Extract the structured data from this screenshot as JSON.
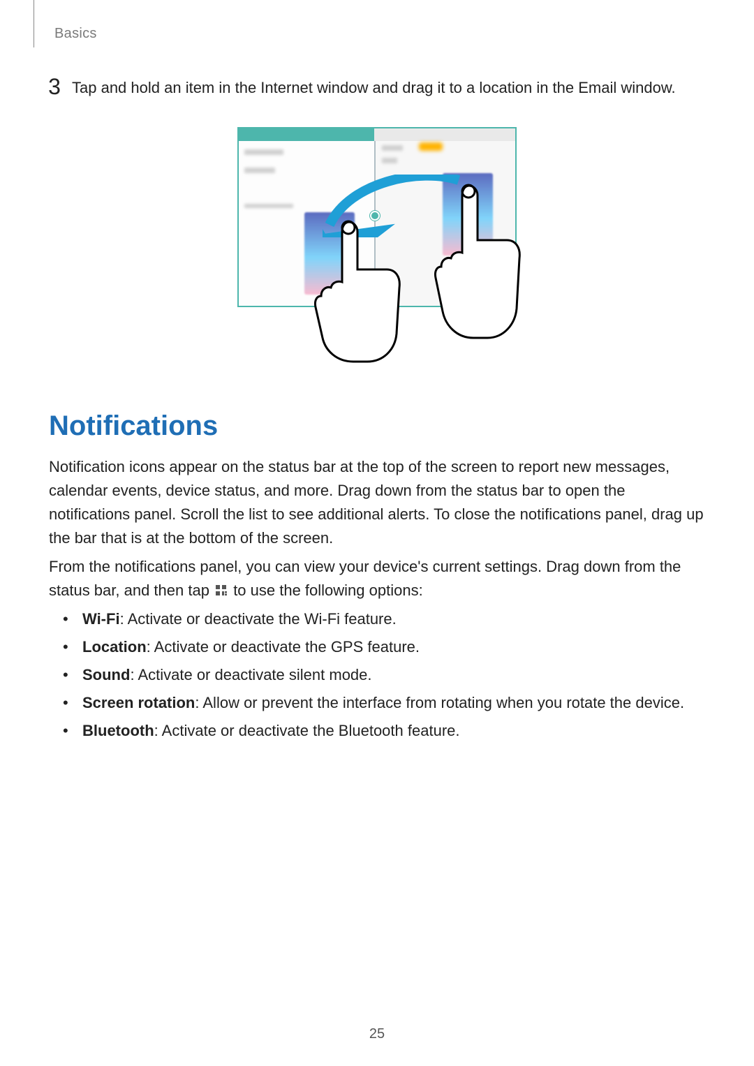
{
  "header": {
    "section": "Basics"
  },
  "step": {
    "number": "3",
    "text": "Tap and hold an item in the Internet window and drag it to a location in the Email window."
  },
  "section": {
    "title": "Notifications"
  },
  "paragraphs": {
    "p1": "Notification icons appear on the status bar at the top of the screen to report new messages, calendar events, device status, and more. Drag down from the status bar to open the notifications panel. Scroll the list to see additional alerts. To close the notifications panel, drag up the bar that is at the bottom of the screen.",
    "p2a": "From the notifications panel, you can view your device's current settings. Drag down from the status bar, and then tap ",
    "p2b": " to use the following options:"
  },
  "bullets": [
    {
      "term": "Wi-Fi",
      "desc": ": Activate or deactivate the Wi-Fi feature."
    },
    {
      "term": "Location",
      "desc": ": Activate or deactivate the GPS feature."
    },
    {
      "term": "Sound",
      "desc": ": Activate or deactivate silent mode."
    },
    {
      "term": "Screen rotation",
      "desc": ": Allow or prevent the interface from rotating when you rotate the device."
    },
    {
      "term": "Bluetooth",
      "desc": ": Activate or deactivate the Bluetooth feature."
    }
  ],
  "page_number": "25",
  "icons": {
    "quick_settings": "quick-settings-grid-icon"
  }
}
